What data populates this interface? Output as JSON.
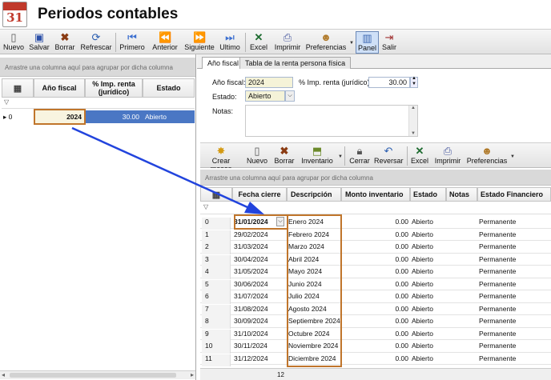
{
  "app": {
    "icon_top": "",
    "icon_num": "31",
    "title": "Periodos contables"
  },
  "toolbar": {
    "nuevo": "Nuevo",
    "salvar": "Salvar",
    "borrar": "Borrar",
    "refrescar": "Refrescar",
    "primero": "Primero",
    "anterior": "Anterior",
    "siguiente": "Siguiente",
    "ultimo": "Ultimo",
    "excel": "Excel",
    "imprimir": "Imprimir",
    "preferencias": "Preferencias",
    "panel": "Panel",
    "salir": "Salir"
  },
  "left_grid": {
    "group_hint": "Arrastre una columna aquí para agrupar por dicha columna",
    "headers": {
      "year": "Año fiscal",
      "pct": "% Imp. renta\n(jurídico)",
      "status": "Estado"
    },
    "filter_icon": "filter-icon",
    "row": {
      "index": "0",
      "year": "2024",
      "pct": "30.00",
      "status": "Abierto"
    }
  },
  "tabs": [
    "Año fiscal",
    "Tabla de la renta persona física"
  ],
  "form": {
    "year_label": "Año fiscal:",
    "year_value": "2024",
    "pct_label": "% Imp. renta (jurídico):",
    "pct_value": "30.00",
    "status_label": "Estado:",
    "status_value": "Abierto",
    "notes_label": "Notas:"
  },
  "sub_toolbar": {
    "crear_meses": "Crear meses",
    "nuevo": "Nuevo",
    "borrar": "Borrar",
    "inventario": "Inventario",
    "cerrar": "Cerrar",
    "reversar": "Reversar",
    "excel": "Excel",
    "imprimir": "Imprimir",
    "preferencias": "Preferencias"
  },
  "months_grid": {
    "group_hint": "Arrastre una columna aquí para agrupar por dicha columna",
    "headers": {
      "fecha": "Fecha cierre",
      "desc": "Descripción",
      "monto": "Monto inventario",
      "estado": "Estado",
      "notas": "Notas",
      "financiero": "Estado Financiero"
    },
    "rows": [
      {
        "i": "0",
        "fecha": "31/01/2024",
        "desc": "Enero 2024",
        "monto": "0.00",
        "estado": "Abierto",
        "fin": "Permanente"
      },
      {
        "i": "1",
        "fecha": "29/02/2024",
        "desc": "Febrero 2024",
        "monto": "0.00",
        "estado": "Abierto",
        "fin": "Permanente"
      },
      {
        "i": "2",
        "fecha": "31/03/2024",
        "desc": "Marzo 2024",
        "monto": "0.00",
        "estado": "Abierto",
        "fin": "Permanente"
      },
      {
        "i": "3",
        "fecha": "30/04/2024",
        "desc": "Abril 2024",
        "monto": "0.00",
        "estado": "Abierto",
        "fin": "Permanente"
      },
      {
        "i": "4",
        "fecha": "31/05/2024",
        "desc": "Mayo 2024",
        "monto": "0.00",
        "estado": "Abierto",
        "fin": "Permanente"
      },
      {
        "i": "5",
        "fecha": "30/06/2024",
        "desc": "Junio 2024",
        "monto": "0.00",
        "estado": "Abierto",
        "fin": "Permanente"
      },
      {
        "i": "6",
        "fecha": "31/07/2024",
        "desc": "Julio 2024",
        "monto": "0.00",
        "estado": "Abierto",
        "fin": "Permanente"
      },
      {
        "i": "7",
        "fecha": "31/08/2024",
        "desc": "Agosto 2024",
        "monto": "0.00",
        "estado": "Abierto",
        "fin": "Permanente"
      },
      {
        "i": "8",
        "fecha": "30/09/2024",
        "desc": "Septiembre 2024",
        "monto": "0.00",
        "estado": "Abierto",
        "fin": "Permanente"
      },
      {
        "i": "9",
        "fecha": "31/10/2024",
        "desc": "Octubre 2024",
        "monto": "0.00",
        "estado": "Abierto",
        "fin": "Permanente"
      },
      {
        "i": "10",
        "fecha": "30/11/2024",
        "desc": "Noviembre 2024",
        "monto": "0.00",
        "estado": "Abierto",
        "fin": "Permanente"
      },
      {
        "i": "11",
        "fecha": "31/12/2024",
        "desc": "Diciembre 2024",
        "monto": "0.00",
        "estado": "Abierto",
        "fin": "Permanente"
      }
    ],
    "count": "12"
  },
  "colors": {
    "selected_row": "#4a77c4",
    "highlight_box": "#c0752b",
    "arrow": "#2244dd",
    "edit_cell": "#f8f4e0"
  }
}
